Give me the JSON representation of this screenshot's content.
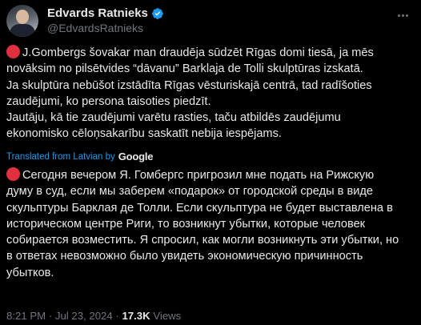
{
  "author": {
    "name": "Edvards Ratnieks",
    "handle": "@EdvardsRatnieks"
  },
  "original_text": [
    "J.Gombergs šovakar man draudēja sūdzēt Rīgas domi tiesā, ja mēs",
    "novāksim no pilsētvides “dāvanu” Barklaja de Tolli skulptūras izskatā.",
    "Ja skulptūra nebūšot izstādīta Rīgas vēsturiskajā centrā, tad radīšoties",
    "zaudējumi, ko persona taisoties piedzīt.",
    "Jautāju, kā tie zaudējumi varētu rasties, taču atbildēs zaudējumu",
    "ekonomisko cēloņsakarību saskatīt nebija iespējams."
  ],
  "translation": {
    "label": "Translated from Latvian by",
    "provider": "Google"
  },
  "translated_text": [
    "Сегодня вечером Я. Гомбергс пригрозил мне подать на Рижскую",
    "думу в суд, если мы заберем «подарок» от городской среды в виде",
    "скульптуры Барклая де Толли. Если скульптура не будет выставлена в",
    "историческом центре Риги, то возникнут убытки, которые человек",
    "собирается возместить. Я спросил, как могли возникнуть эти убытки, но",
    "в ответах невозможно было увидеть экономическую причинность",
    "убытков."
  ],
  "meta": {
    "time": "8:21 PM",
    "date": "Jul 23, 2024",
    "views_count": "17.3K",
    "views_label": "Views"
  },
  "colors": {
    "background": "#000000",
    "accent": "#1d9bf0",
    "red_dot": "#e0303d"
  }
}
